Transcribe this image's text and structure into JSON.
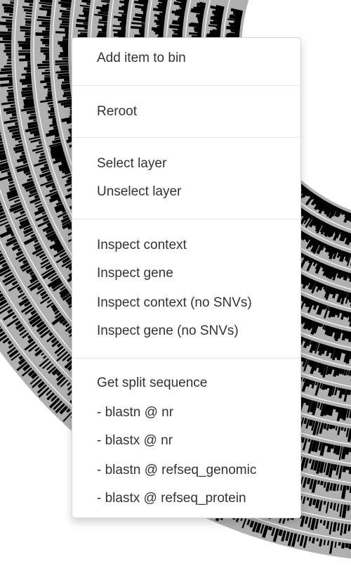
{
  "colors": {
    "ring_fill": "#b0b0b0",
    "ring_bar": "#000000",
    "menu_bg": "#ffffff",
    "menu_text": "#333333",
    "divider": "#e5e5e5"
  },
  "context_menu": {
    "items": [
      {
        "label": "Add item to bin"
      },
      {
        "label": "Reroot"
      },
      {
        "label": "Select layer"
      },
      {
        "label": "Unselect layer"
      },
      {
        "label": "Inspect context"
      },
      {
        "label": "Inspect gene"
      },
      {
        "label": "Inspect context (no SNVs)"
      },
      {
        "label": "Inspect gene (no SNVs)"
      },
      {
        "label": "Get split sequence"
      },
      {
        "label": "- blastn @ nr"
      },
      {
        "label": "- blastx @ nr"
      },
      {
        "label": "- blastn @ refseq_genomic"
      },
      {
        "label": "- blastx @ refseq_protein"
      }
    ]
  }
}
